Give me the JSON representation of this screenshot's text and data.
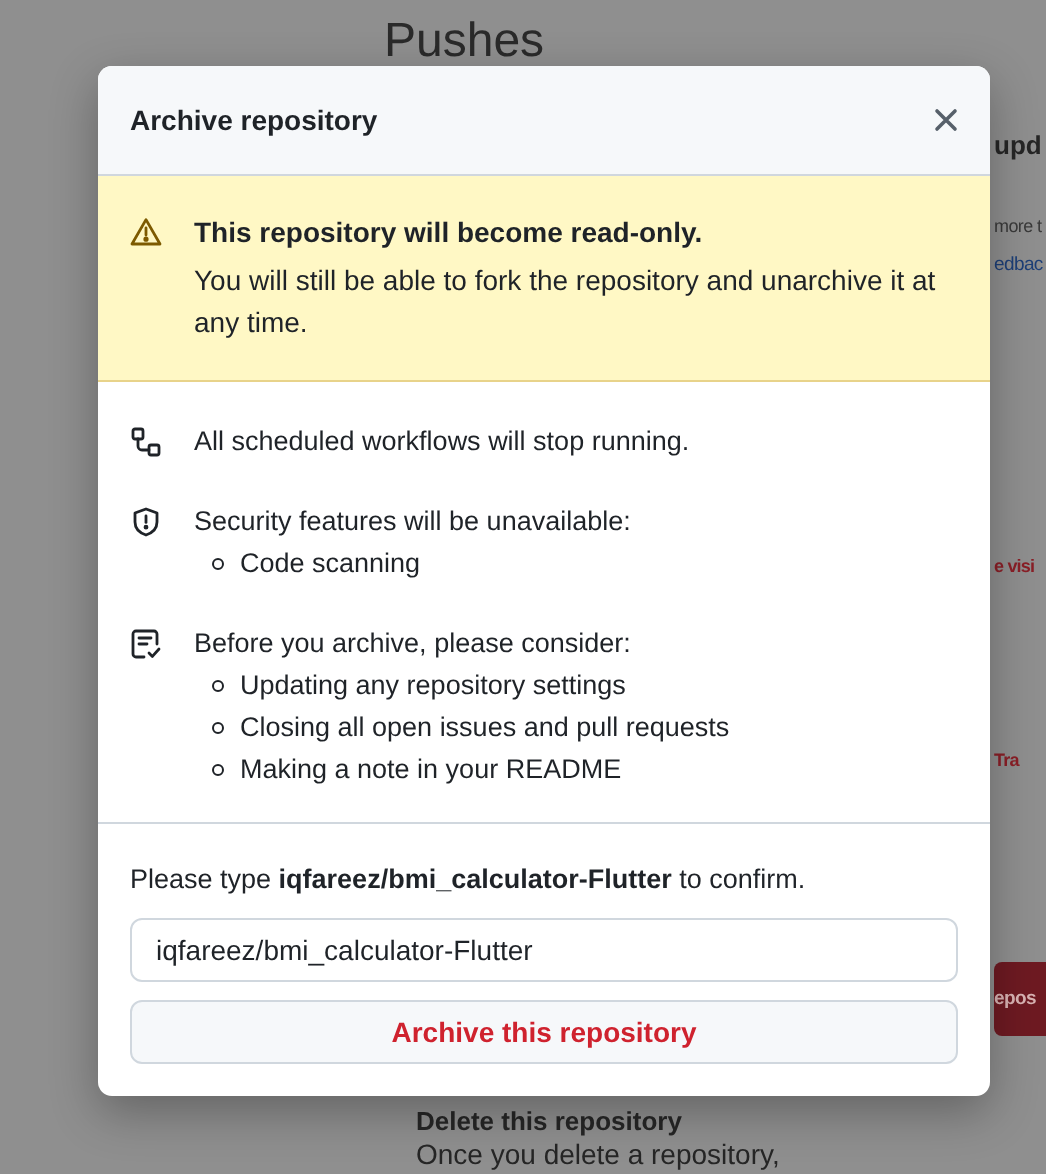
{
  "background": {
    "heading": "Pushes",
    "fragments": [
      {
        "text": "upd",
        "kind": "title"
      },
      {
        "text": "more t",
        "kind": "text"
      },
      {
        "text": "edbac",
        "kind": "link"
      },
      {
        "text": "e visi",
        "kind": "danger"
      },
      {
        "text": "Tra",
        "kind": "danger"
      },
      {
        "text": "epos",
        "kind": "danger-button"
      }
    ],
    "delete_title": "Delete this repository",
    "delete_text": "Once you delete a repository,"
  },
  "dialog": {
    "title": "Archive repository",
    "warning": {
      "title": "This repository will become read-only.",
      "text": "You will still be able to fork the repository and unarchive it at any time."
    },
    "items": [
      {
        "kind": "workflow",
        "text": "All scheduled workflows will stop running."
      },
      {
        "kind": "shield",
        "text": "Security features will be unavailable:",
        "bullets": [
          "Code scanning"
        ]
      },
      {
        "kind": "checklist",
        "text": "Before you archive, please consider:",
        "bullets": [
          "Updating any repository settings",
          "Closing all open issues and pull requests",
          "Making a note in your README"
        ]
      }
    ],
    "confirm": "Please type **iqfareez/bmi_calculator-Flutter** to confirm.",
    "input": {
      "value": "iqfareez/bmi_calculator-Flutter"
    },
    "button": "Archive this repository"
  }
}
